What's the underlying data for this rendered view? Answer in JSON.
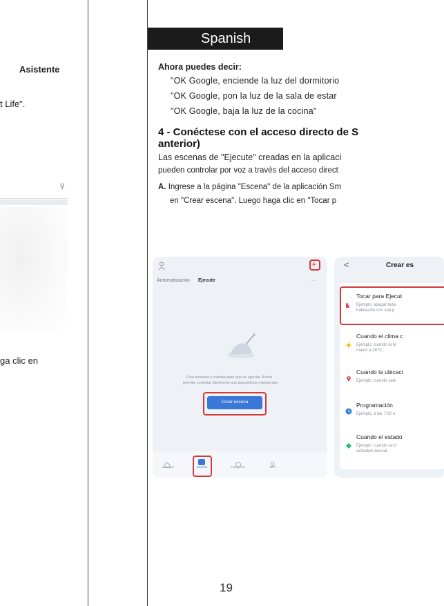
{
  "left_page": {
    "line1": "Asistente",
    "line2": "t Life\".",
    "line3": "ga clic en"
  },
  "right_page": {
    "language_tag": "Spanish",
    "now_you_can_say": "Ahora puedes decir:",
    "commands": [
      "\"OK Google, enciende la luz del dormitorio",
      "\"OK Google, pon la luz de la sala de estar",
      "\"OK Google, baja la luz de la cocina\""
    ],
    "section_title_line1": "4 - Conéctese con el acceso directo de S",
    "section_title_line2": "anterior)",
    "paragraph_line1": "Las escenas de \"Ejecute\" creadas en la aplicaci",
    "paragraph_line2": "pueden controlar por voz a través del acceso direct",
    "step_a_label": "A.",
    "step_a_line1": "Ingrese a la página \"Escena\" de la aplicación Sm",
    "step_a_line2": "en \"Crear escena\". Luego haga clic en \"Tocar p",
    "page_number": "19"
  },
  "phone1": {
    "tab_automation": "Automatización",
    "tab_execute": "Ejecute",
    "add_icon": "+",
    "empty_text_line1": "Cree escenas y cuando para que se ejecute. Active",
    "empty_text_line2": "permite controlar fácilmente sus dispositivos inteligentes",
    "create_button": "Crear escena",
    "nav": [
      "Mi hogar",
      "Escena",
      "Inteligente",
      "Yo"
    ]
  },
  "phone2": {
    "back": "<",
    "title": "Crear es",
    "options": [
      {
        "title": "Tocar para Ejecut",
        "sub1": "Ejemplo: apagar toda",
        "sub2": "habitación con una p",
        "color": "#e5484d"
      },
      {
        "title": "Cuando el clima c",
        "sub1": "Ejemplo: cuando la te",
        "sub2": "mayor a 28 ºC.",
        "color": "#f5b800"
      },
      {
        "title": "Cuando la ubicaci",
        "sub1": "Ejemplo: cuando sale",
        "sub2": "",
        "color": "#e5484d"
      },
      {
        "title": "Programación",
        "sub1": "Ejemplo: a las 7:00 a",
        "sub2": "",
        "color": "#3b82d6"
      },
      {
        "title": "Cuando el estado",
        "sub1": "Ejemplo: cuando se d",
        "sub2": "actividad inusual.",
        "color": "#2bb673"
      }
    ]
  }
}
